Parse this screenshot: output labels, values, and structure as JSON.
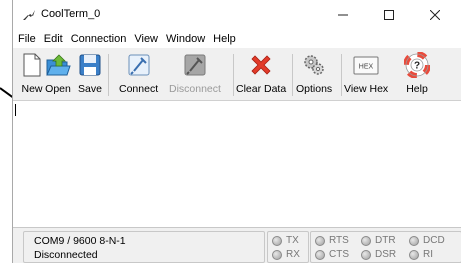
{
  "window": {
    "title": "CoolTerm_0"
  },
  "menu": [
    "File",
    "Edit",
    "Connection",
    "View",
    "Window",
    "Help"
  ],
  "toolbar": {
    "new": "New",
    "open": "Open",
    "save": "Save",
    "connect": "Connect",
    "disconnect": "Disconnect",
    "clear_data": "Clear Data",
    "options": "Options",
    "view_hex": "View Hex",
    "view_hex_icon_text": "HEX",
    "help": "Help"
  },
  "status": {
    "port": "COM9 / 9600 8-N-1",
    "state": "Disconnected",
    "leds": {
      "tx": "TX",
      "rx": "RX",
      "rts": "RTS",
      "cts": "CTS",
      "dtr": "DTR",
      "dsr": "DSR",
      "dcd": "DCD",
      "ri": "RI"
    }
  },
  "colors": {
    "accent_red": "#e23b2a",
    "help_ring": "#e94b3c",
    "window_bg": "#f0f0f0"
  }
}
